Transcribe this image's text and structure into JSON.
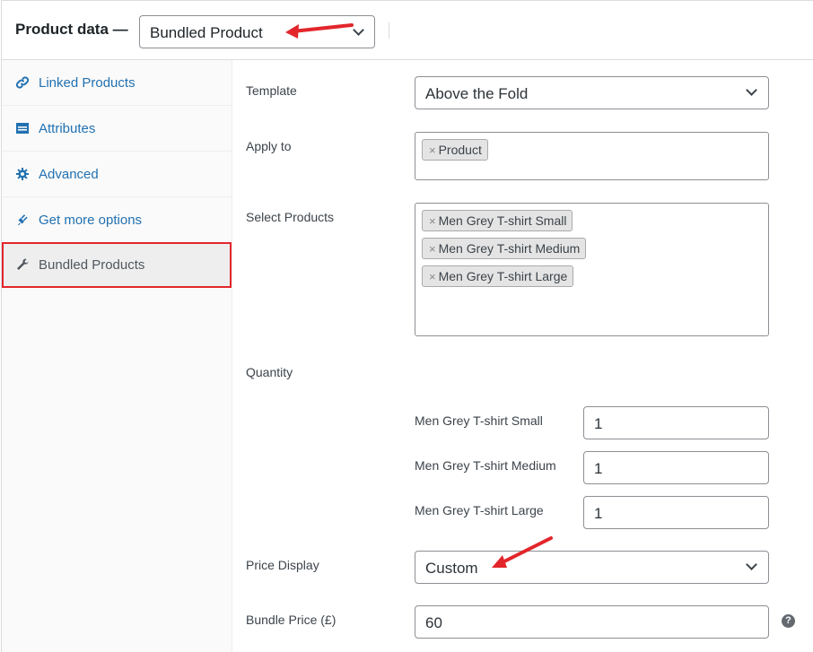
{
  "header": {
    "title": "Product data —",
    "product_type": "Bundled Product"
  },
  "sidebar": {
    "items": [
      {
        "label": "Linked Products",
        "icon": "link-icon"
      },
      {
        "label": "Attributes",
        "icon": "attributes-icon"
      },
      {
        "label": "Advanced",
        "icon": "gear-icon"
      },
      {
        "label": "Get more options",
        "icon": "plugin-icon"
      },
      {
        "label": "Bundled Products",
        "icon": "wrench-icon",
        "active": true
      }
    ]
  },
  "form": {
    "template": {
      "label": "Template",
      "value": "Above the Fold"
    },
    "apply_to": {
      "label": "Apply to",
      "chips": [
        "Product"
      ]
    },
    "select_products": {
      "label": "Select Products",
      "chips": [
        "Men Grey T-shirt Small",
        "Men Grey T-shirt Medium",
        "Men Grey T-shirt Large"
      ]
    },
    "quantity": {
      "label": "Quantity",
      "items": [
        {
          "label": "Men Grey T-shirt Small",
          "value": "1"
        },
        {
          "label": "Men Grey T-shirt Medium",
          "value": "1"
        },
        {
          "label": "Men Grey T-shirt Large",
          "value": "1"
        }
      ]
    },
    "price_display": {
      "label": "Price Display",
      "value": "Custom"
    },
    "bundle_price": {
      "label": "Bundle Price (£)",
      "value": "60",
      "help": "?"
    }
  },
  "chip_remove_glyph": "×",
  "colors": {
    "accent": "#2271b1",
    "highlight_border": "#e2262b",
    "arrow": "#e2262b"
  }
}
